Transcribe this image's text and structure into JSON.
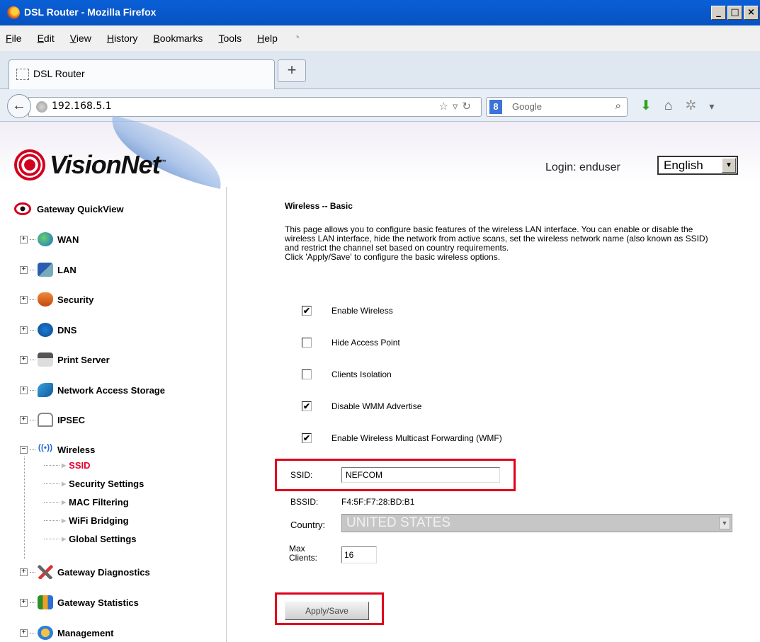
{
  "window": {
    "title": "DSL Router - Mozilla Firefox"
  },
  "menu": [
    "File",
    "Edit",
    "View",
    "History",
    "Bookmarks",
    "Tools",
    "Help"
  ],
  "tab": {
    "title": "DSL Router"
  },
  "nav": {
    "url": "192.168.5.1",
    "search_placeholder": "Google"
  },
  "header": {
    "brand": "VisionNet",
    "login_label": "Login: enduser",
    "language": "English"
  },
  "sidebar": {
    "quickview": "Gateway QuickView",
    "items": [
      "WAN",
      "LAN",
      "Security",
      "DNS",
      "Print Server",
      "Network Access Storage",
      "IPSEC",
      "Wireless",
      "Gateway Diagnostics",
      "Gateway Statistics",
      "Management"
    ],
    "wireless_sub": [
      "SSID",
      "Security Settings",
      "MAC Filtering",
      "WiFi Bridging",
      "Global Settings"
    ],
    "active_sub": "SSID"
  },
  "content": {
    "title": "Wireless -- Basic",
    "description": "This page allows you to configure basic features of the wireless LAN interface. You can enable or disable the wireless LAN interface, hide the network from active scans, set the wireless network name (also known as SSID) and restrict the channel set based on country requirements.",
    "description2": "Click 'Apply/Save' to configure the basic wireless options.",
    "checkboxes": [
      {
        "label": "Enable Wireless",
        "checked": true
      },
      {
        "label": "Hide Access Point",
        "checked": false
      },
      {
        "label": "Clients Isolation",
        "checked": false
      },
      {
        "label": "Disable WMM Advertise",
        "checked": true
      },
      {
        "label": "Enable Wireless Multicast Forwarding (WMF)",
        "checked": true
      }
    ],
    "ssid_label": "SSID:",
    "ssid_value": "NEFCOM",
    "bssid_label": "BSSID:",
    "bssid_value": "F4:5F:F7:28:BD:B1",
    "country_label": "Country:",
    "country_value": "UNITED STATES",
    "max_clients_label_1": "Max",
    "max_clients_label_2": "Clients:",
    "max_clients_value": "16",
    "apply_label": "Apply/Save"
  },
  "colors": {
    "highlight": "#e0001b",
    "active_link": "#e8002a",
    "titlebar": "#0a5fd6"
  }
}
